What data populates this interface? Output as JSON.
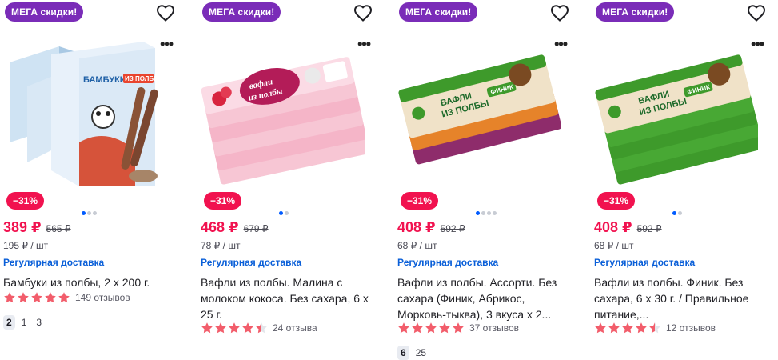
{
  "colors": {
    "mega_badge": "#7a2cb8",
    "discount_badge": "#f1124f",
    "price": "#f1124f",
    "delivery": "#0a5fd8",
    "star": "#f25d6b"
  },
  "products": [
    {
      "mega_label": "МЕГА скидки!",
      "discount": "−31%",
      "price": "389 ₽",
      "old_price": "565 ₽",
      "unit_price": "195 ₽ / шт",
      "delivery": "Регулярная доставка",
      "title": "Бамбуки из полбы, 2 х 200 г.",
      "rating": 5,
      "reviews": "149 отзывов",
      "variants": [
        "2",
        "1",
        "3"
      ],
      "image_icon": "bamboo-wafer-package-image",
      "image_text": [
        "БАМБУКИ",
        "ИЗ ПОЛБЫ"
      ]
    },
    {
      "mega_label": "МЕГА скидки!",
      "discount": "−31%",
      "price": "468 ₽",
      "old_price": "679 ₽",
      "unit_price": "78 ₽ / шт",
      "delivery": "Регулярная доставка",
      "title": "Вафли из полбы. Малина с молоком кокоса. Без сахара, 6 х 25 г.",
      "rating": 4.5,
      "reviews": "24 отзыва",
      "variants": [],
      "image_icon": "raspberry-wafer-package-image",
      "image_text": [
        "вафли",
        "из полбы"
      ]
    },
    {
      "mega_label": "МЕГА скидки!",
      "discount": "−31%",
      "price": "408 ₽",
      "old_price": "592 ₽",
      "unit_price": "68 ₽ / шт",
      "delivery": "Регулярная доставка",
      "title": "Вафли из полбы. Ассорти. Без сахара (Финик, Абрикос, Морковь-тыква), 3 вкуса х 2...",
      "rating": 5,
      "reviews": "37 отзывов",
      "variants": [
        "6",
        "25"
      ],
      "image_icon": "assorted-wafer-package-image",
      "image_text": [
        "ВАФЛИ",
        "ИЗ ПОЛБЫ",
        "ФИНИК"
      ]
    },
    {
      "mega_label": "МЕГА скидки!",
      "discount": "−31%",
      "price": "408 ₽",
      "old_price": "592 ₽",
      "unit_price": "68 ₽ / шт",
      "delivery": "Регулярная доставка",
      "title": "Вафли из полбы. Финик. Без сахара, 6 х 30 г. / Правильное питание,...",
      "rating": 4.5,
      "reviews": "12 отзывов",
      "variants": [],
      "image_icon": "date-wafer-package-image",
      "image_text": [
        "ВАФЛИ",
        "ИЗ ПОЛБЫ",
        "ФИНИК"
      ]
    }
  ]
}
